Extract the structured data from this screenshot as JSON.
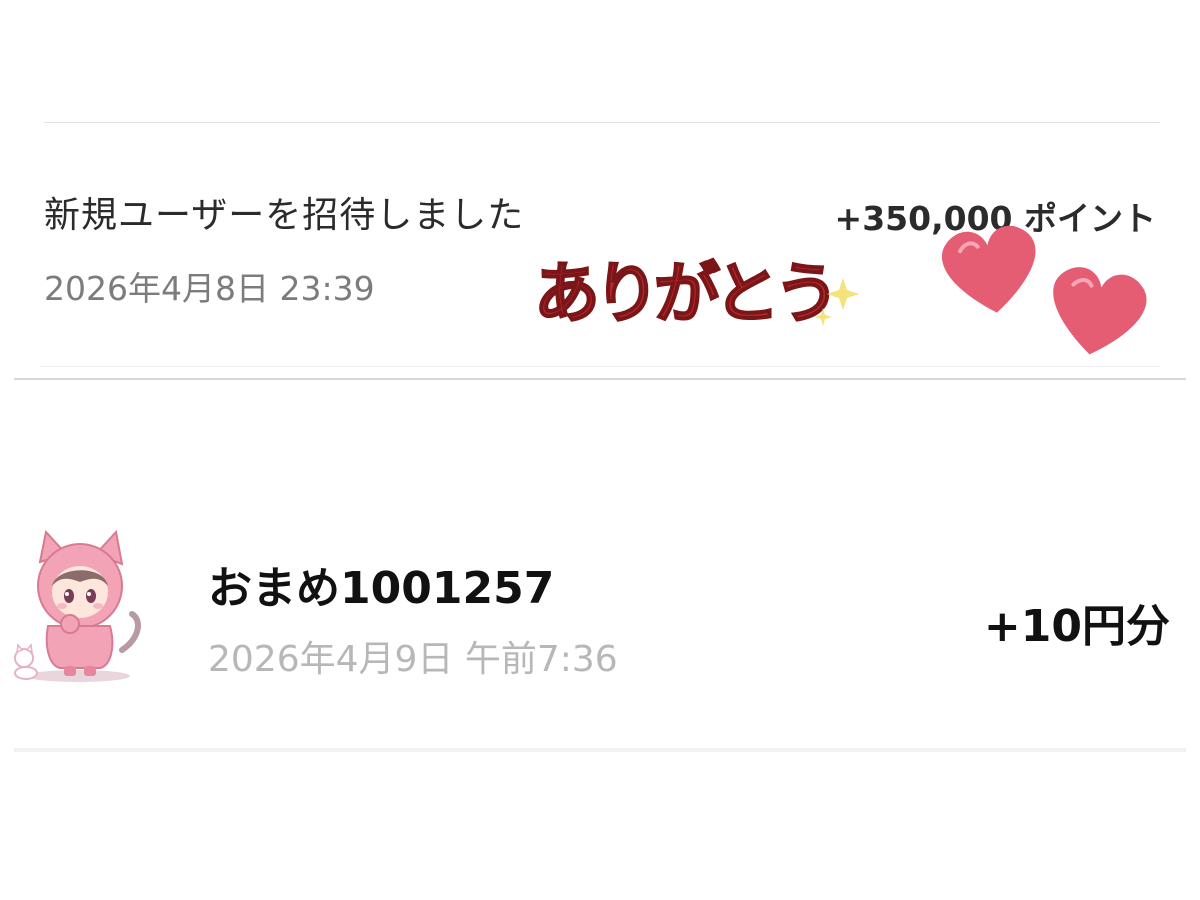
{
  "transactions": [
    {
      "title": "新規ユーザーを招待しました",
      "datetime": "2026年4月8日 23:39",
      "amount": "+350,000 ポイント"
    },
    {
      "name": "おまめ1001257",
      "datetime": "2026年4月9日 午前7:36",
      "amount": "+10円分"
    }
  ],
  "sticker": {
    "text": "ありがとう",
    "color": "#b6282c"
  },
  "hearts_color": "#e45d73",
  "avatar": {
    "icon": "pink-cat-hoodie-girl-icon",
    "color": "#f2a4b6"
  },
  "colors": {
    "text_primary": "#111111",
    "text_secondary": "#7c7c7c",
    "text_muted": "#b7b7b7",
    "divider": "#d7d7d7"
  }
}
